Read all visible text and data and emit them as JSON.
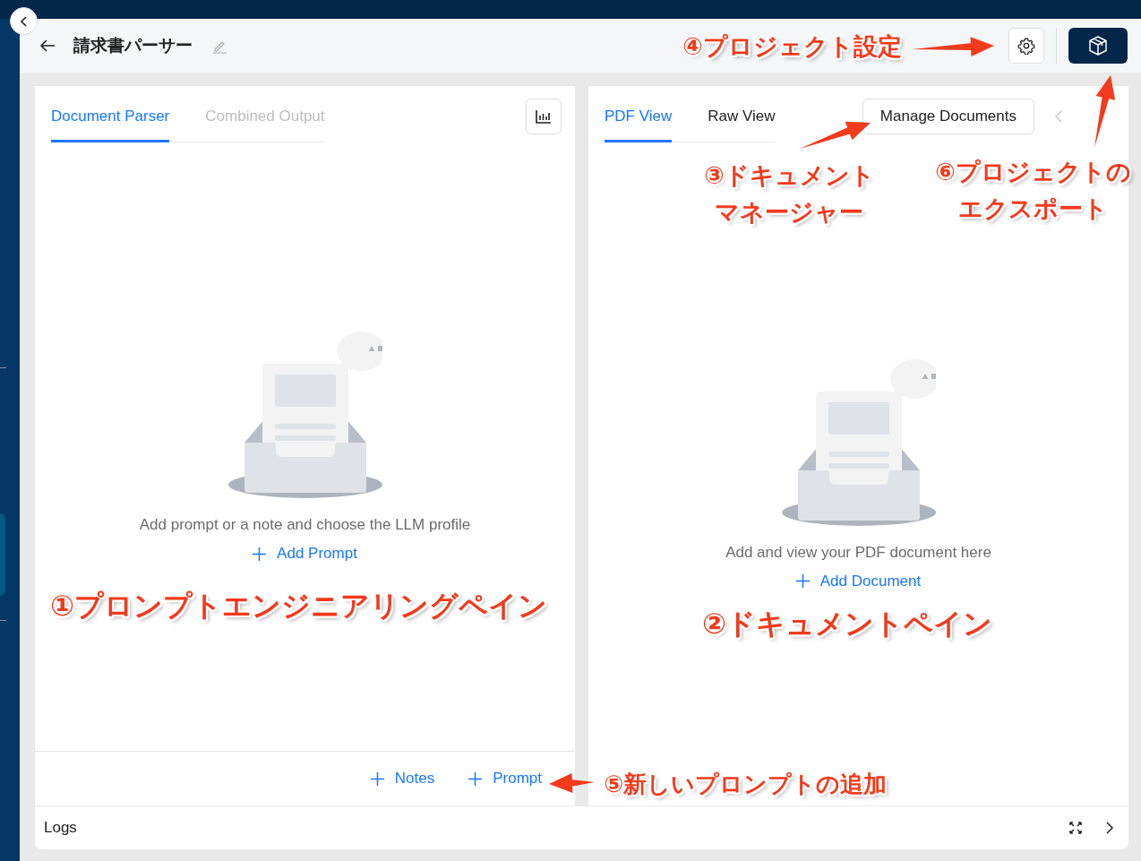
{
  "header": {
    "title": "請求書パーサー"
  },
  "left_pane": {
    "tabs": [
      {
        "label": "Document Parser",
        "selected": true,
        "disabled": false
      },
      {
        "label": "Combined Output",
        "selected": false,
        "disabled": true
      }
    ],
    "empty_message": "Add prompt or a note and choose the LLM profile",
    "add_link": "Add Prompt",
    "footer_buttons": [
      "Notes",
      "Prompt"
    ]
  },
  "right_pane": {
    "tabs": [
      {
        "label": "PDF View",
        "selected": true,
        "disabled": false
      },
      {
        "label": "Raw View",
        "selected": false,
        "disabled": false
      }
    ],
    "manage_button": "Manage Documents",
    "empty_message": "Add and view your PDF document here",
    "add_link": "Add Document"
  },
  "logs": {
    "label": "Logs"
  },
  "annotations": [
    {
      "lines": [
        "④プロジェクト設定"
      ]
    },
    {
      "lines": [
        "③ドキュメント",
        "マネージャー"
      ]
    },
    {
      "lines": [
        "⑥プロジェクトの",
        "エクスポート"
      ]
    },
    {
      "lines": [
        "①プロンプトエンジニアリングペイン"
      ]
    },
    {
      "lines": [
        "②ドキュメントペイン"
      ]
    },
    {
      "lines": [
        "⑤新しいプロンプトの追加"
      ]
    }
  ]
}
